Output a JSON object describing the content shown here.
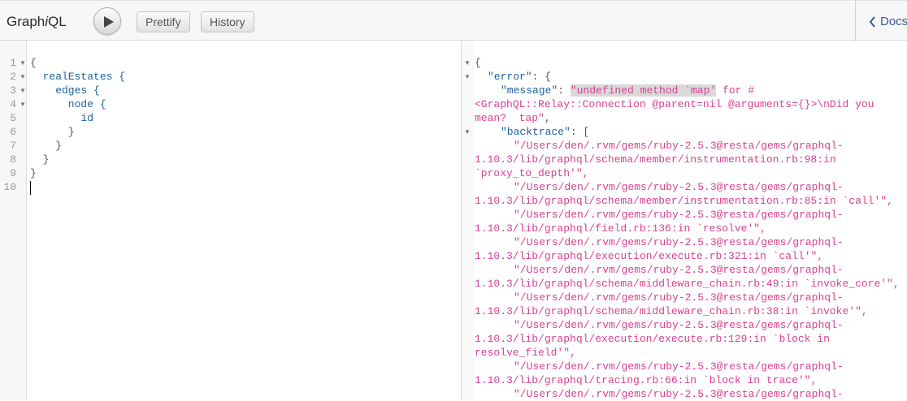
{
  "toolbar": {
    "title_prefix": "Graph",
    "title_italic": "i",
    "title_suffix": "QL",
    "prettify_label": "Prettify",
    "history_label": "History",
    "docs_label": "Docs"
  },
  "query_editor": {
    "lines": [
      {
        "number": "1",
        "text": "{"
      },
      {
        "number": "2",
        "text": "  realEstates {"
      },
      {
        "number": "3",
        "text": "    edges {"
      },
      {
        "number": "4",
        "text": "      node {"
      },
      {
        "number": "5",
        "text": "        id"
      },
      {
        "number": "6",
        "text": "      }"
      },
      {
        "number": "7",
        "text": "    }"
      },
      {
        "number": "8",
        "text": "  }"
      },
      {
        "number": "9",
        "text": "}"
      },
      {
        "number": "10",
        "text": ""
      }
    ]
  },
  "result_viewer": {
    "open_brace": "{",
    "error_key": "\"error\"",
    "error_open": ": {",
    "message_key": "\"message\"",
    "message_highlight": "\"undefined method `map'",
    "message_rest": " for #",
    "message_cont1": "<GraphQL::Relay::Connection @parent=nil @arguments={}>\\nDid you",
    "message_cont2": "mean?  tap\"",
    "comma": ",",
    "backtrace_key": "\"backtrace\"",
    "backtrace_open": ": [",
    "backtrace_lines": [
      "\"/Users/den/.rvm/gems/ruby-2.5.3@resta/gems/graphql-",
      "1.10.3/lib/graphql/schema/member/instrumentation.rb:98:in",
      "`proxy_to_depth'\",",
      "\"/Users/den/.rvm/gems/ruby-2.5.3@resta/gems/graphql-",
      "1.10.3/lib/graphql/schema/member/instrumentation.rb:85:in `call'\",",
      "\"/Users/den/.rvm/gems/ruby-2.5.3@resta/gems/graphql-",
      "1.10.3/lib/graphql/field.rb:136:in `resolve'\",",
      "\"/Users/den/.rvm/gems/ruby-2.5.3@resta/gems/graphql-",
      "1.10.3/lib/graphql/execution/execute.rb:321:in `call'\",",
      "\"/Users/den/.rvm/gems/ruby-2.5.3@resta/gems/graphql-",
      "1.10.3/lib/graphql/schema/middleware_chain.rb:49:in `invoke_core'\",",
      "\"/Users/den/.rvm/gems/ruby-2.5.3@resta/gems/graphql-",
      "1.10.3/lib/graphql/schema/middleware_chain.rb:38:in `invoke'\",",
      "\"/Users/den/.rvm/gems/ruby-2.5.3@resta/gems/graphql-",
      "1.10.3/lib/graphql/execution/execute.rb:129:in `block in",
      "resolve_field'\",",
      "\"/Users/den/.rvm/gems/ruby-2.5.3@resta/gems/graphql-",
      "1.10.3/lib/graphql/tracing.rb:66:in `block in trace'\",",
      "\"/Users/den/.rvm/gems/ruby-2.5.3@resta/gems/graphql-"
    ]
  },
  "colors": {
    "key": "#1f61a0",
    "string": "#d64292",
    "link": "#3b5998"
  },
  "icons": {
    "run": "play-icon",
    "docs": "chevron-left-icon",
    "fold": "fold-arrow-icon"
  }
}
